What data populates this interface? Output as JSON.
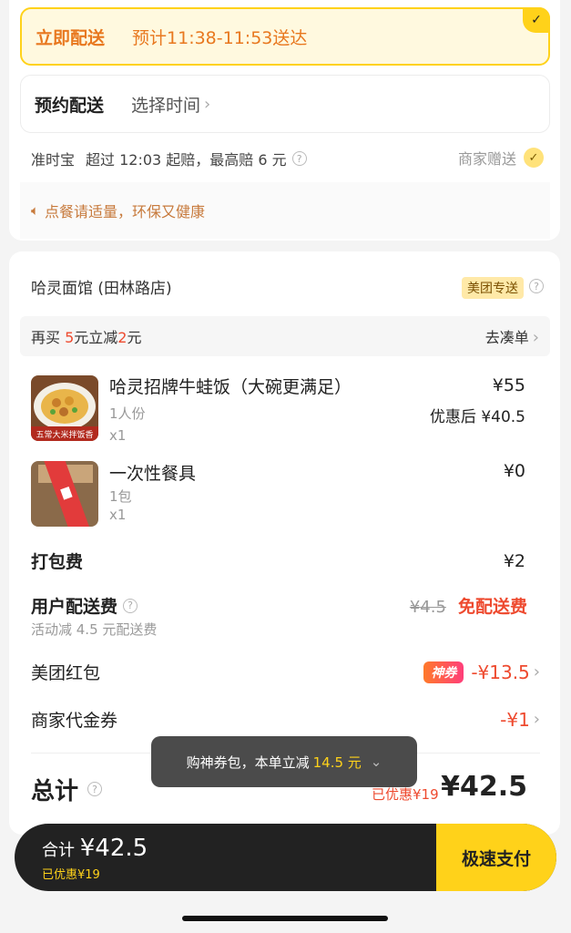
{
  "delivery": {
    "now_title": "立即配送",
    "now_eta": "预计11:38-11:53送达",
    "later_title": "预约配送",
    "later_choose": "选择时间"
  },
  "ontime": {
    "label": "准时宝",
    "desc": "超过 12:03 起赔，最高赔 6 元",
    "merchant_gift": "商家赠送"
  },
  "tip": "点餐请适量，环保又健康",
  "shop": {
    "name": "哈灵面馆 (田林路店)",
    "badge": "美团专送"
  },
  "promo": {
    "prefix": "再买 ",
    "amount1": "5",
    "mid": "元立减",
    "amount2": "2",
    "suffix": "元",
    "action": "去凑单"
  },
  "items": [
    {
      "name": "哈灵招牌牛蛙饭（大碗更满足）",
      "spec": "1人份",
      "qty": "x1",
      "price": "¥55",
      "discounted": "优惠后 ¥40.5",
      "image_caption": "五常大米拌饭香"
    },
    {
      "name": "一次性餐具",
      "spec": "1包",
      "qty": "x1",
      "price": "¥0"
    }
  ],
  "fees": {
    "packing_label": "打包费",
    "packing_value": "¥2",
    "delivery_label": "用户配送费",
    "delivery_orig": "¥4.5",
    "delivery_free": "免配送费",
    "delivery_sub": "活动减 4.5 元配送费",
    "redpacket_label": "美团红包",
    "redpacket_badge": "神券",
    "redpacket_value": "-¥13.5",
    "voucher_label": "商家代金券",
    "voucher_value": "-¥1"
  },
  "toast": {
    "text": "购神券包，本单立减",
    "highlight": "14.5 元"
  },
  "total": {
    "label": "总计",
    "saved": "已优惠¥19",
    "amount": "¥42.5"
  },
  "bottom": {
    "total_label": "合计",
    "total_amount": "¥42.5",
    "saved": "已优惠¥19",
    "pay_label": "极速支付"
  },
  "colors": {
    "accent_yellow": "#ffd21a",
    "accent_orange": "#e8781f",
    "discount_red": "#ee4a2f"
  }
}
